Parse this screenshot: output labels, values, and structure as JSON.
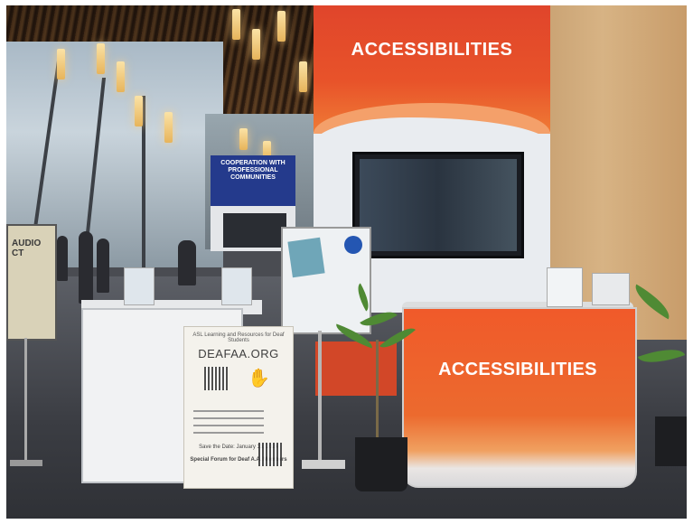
{
  "scene": {
    "description_visible_text": true,
    "booth_panel_title": "ACCESSIBILITIES",
    "counter_title": "ACCESSIBILITIES",
    "cooperation_sign": "COOPERATION WITH PROFESSIONAL COMMUNITIES",
    "left_standee_text": "AUDIO\nCT",
    "poster": {
      "small_header": "ASL Learning and Resources for Deaf Students",
      "title": "DEAFAA.ORG",
      "save_the_date": "Save the Date: January 13, 2024",
      "footer": "Special Forum for Deaf A.A. Members"
    }
  },
  "colors": {
    "booth_orange": "#e8532a",
    "counter_orange": "#f05a2a",
    "navy_sign": "#243a8c",
    "wood_wall": "#d7b384"
  }
}
